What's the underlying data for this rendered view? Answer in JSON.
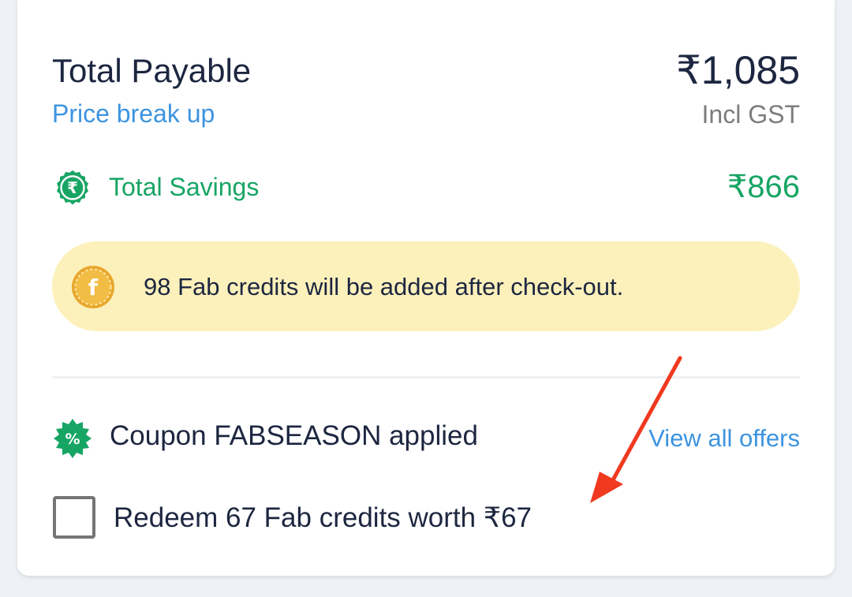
{
  "summary": {
    "title": "Total Payable",
    "price_breakup_link": "Price break up",
    "total_amount": "₹1,085",
    "tax_note": "Incl GST"
  },
  "savings": {
    "label": "Total Savings",
    "amount": "₹866",
    "icon": "rupee-badge-icon",
    "color": "#17a564"
  },
  "credits_banner": {
    "text": "98 Fab credits will be added after check-out.",
    "icon": "fab-coin-icon",
    "background": "#fcf1bb"
  },
  "coupon": {
    "text": "Coupon FABSEASON applied",
    "icon": "discount-badge-icon",
    "offers_link": "View all offers"
  },
  "redeem": {
    "label": "Redeem 67 Fab credits worth ₹67",
    "checked": false
  },
  "colors": {
    "text_primary": "#1d2640",
    "link": "#3d94e0",
    "annotation_arrow": "#f0391f"
  }
}
